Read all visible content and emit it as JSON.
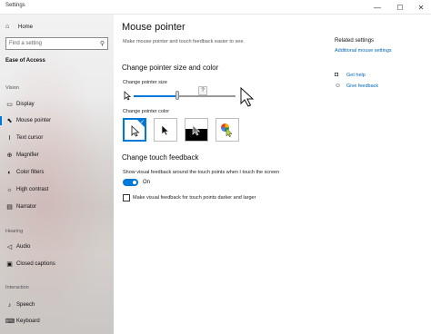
{
  "window": {
    "title": "Settings",
    "min_glyph": "—",
    "max_glyph": "☐",
    "close_glyph": "✕"
  },
  "sidebar": {
    "home_label": "Home",
    "home_icon": "home-icon",
    "search_placeholder": "Find a setting",
    "section_title": "Ease of Access",
    "groups": [
      {
        "label": "Vision"
      },
      {
        "label": "Hearing"
      },
      {
        "label": "Interaction"
      }
    ],
    "items": [
      {
        "label": "Display",
        "icon": "display-icon"
      },
      {
        "label": "Mouse pointer",
        "icon": "mouse-pointer-icon"
      },
      {
        "label": "Text cursor",
        "icon": "text-cursor-icon"
      },
      {
        "label": "Magnifier",
        "icon": "magnifier-icon"
      },
      {
        "label": "Color filters",
        "icon": "color-filters-icon"
      },
      {
        "label": "High contrast",
        "icon": "high-contrast-icon"
      },
      {
        "label": "Narrator",
        "icon": "narrator-icon"
      },
      {
        "label": "Audio",
        "icon": "audio-icon"
      },
      {
        "label": "Closed captions",
        "icon": "closed-captions-icon"
      },
      {
        "label": "Speech",
        "icon": "speech-icon"
      },
      {
        "label": "Keyboard",
        "icon": "keyboard-icon"
      }
    ]
  },
  "main": {
    "title": "Mouse pointer",
    "description": "Make mouse pointer and touch feedback easier to see.",
    "size_section": {
      "heading": "Change pointer size and color",
      "size_label": "Change pointer size",
      "slider_value_fraction": 0.43,
      "tooltip": "?"
    },
    "color_section": {
      "label": "Change pointer color",
      "options": [
        "white",
        "black",
        "inverted",
        "custom"
      ],
      "selected": "white"
    },
    "touch_section": {
      "heading": "Change touch feedback",
      "show_label": "Show visual feedback around the touch points when I touch the screen",
      "toggle_state": "On",
      "darker_label": "Make visual feedback for touch points darker and larger"
    }
  },
  "related": {
    "heading": "Related settings",
    "link": "Additional mouse settings",
    "help_label": "Get help",
    "feedback_label": "Give feedback"
  },
  "colors": {
    "accent": "#0078d7",
    "link": "#0067b8"
  }
}
